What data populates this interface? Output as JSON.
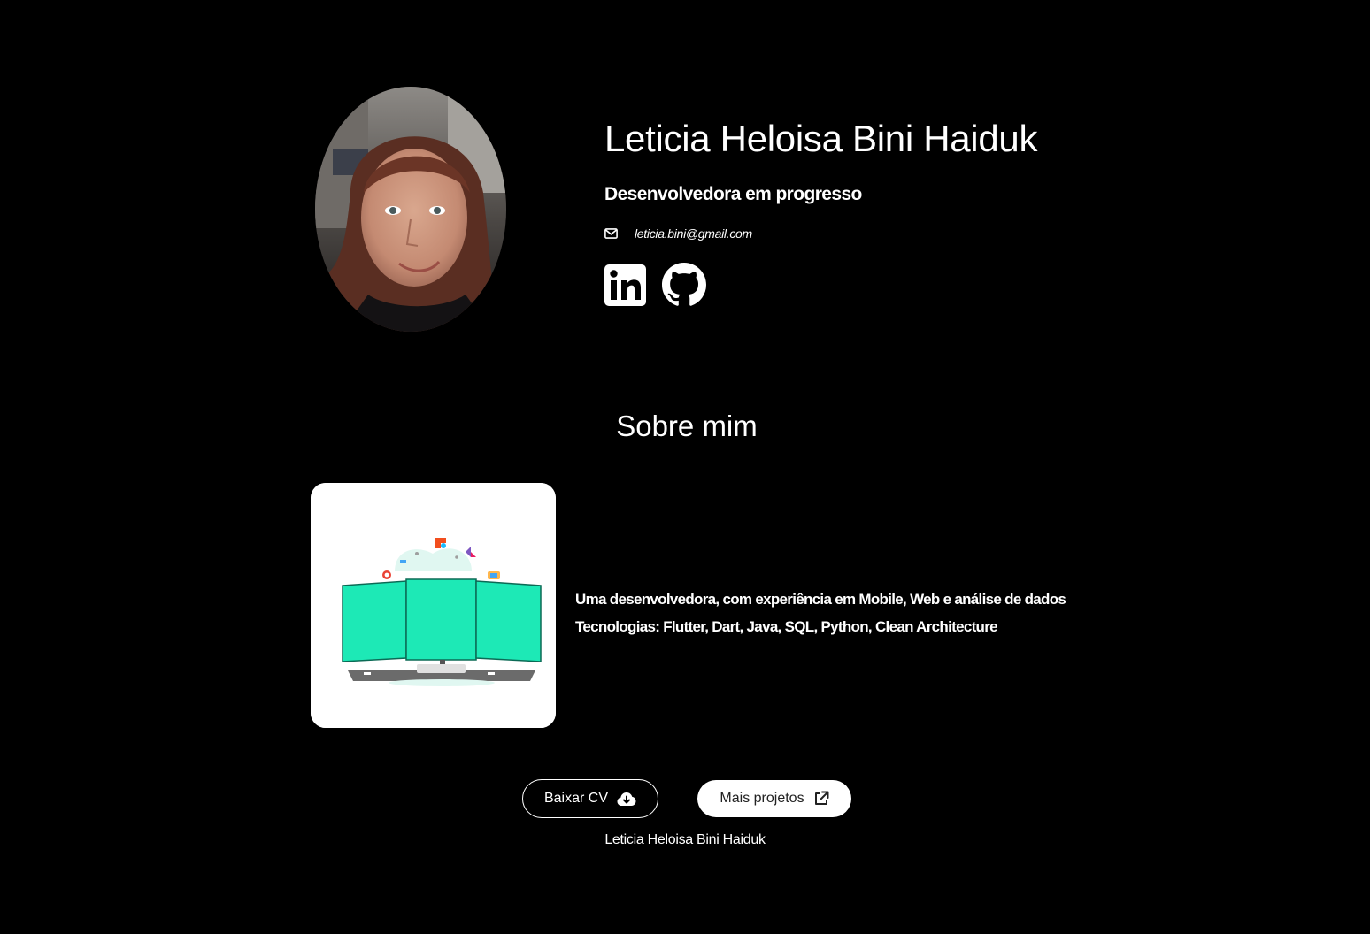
{
  "profile": {
    "name": "Leticia Heloisa Bini Haiduk",
    "subtitle": "Desenvolvedora em progresso",
    "email": "leticia.bini@gmail.com",
    "email_icon": "envelope-icon",
    "socials": [
      {
        "icon": "linkedin-icon"
      },
      {
        "icon": "github-icon"
      }
    ]
  },
  "about": {
    "title": "Sobre mim",
    "lines": [
      "Uma desenvolvedora, com experiência em Mobile, Web e análise de dados",
      "Tecnologias: Flutter, Dart, Java, SQL, Python, Clean Architecture"
    ]
  },
  "actions": {
    "download_cv_label": "Baixar CV",
    "download_cv_icon": "cloud-download-icon",
    "more_projects_label": "Mais projetos",
    "more_projects_icon": "external-link-icon"
  },
  "footer": {
    "text": "Leticia Heloisa Bini Haiduk"
  },
  "colors": {
    "background": "#000000",
    "text": "#ffffff",
    "card": "#ffffff",
    "accent_illustration": "#1de9b6"
  }
}
